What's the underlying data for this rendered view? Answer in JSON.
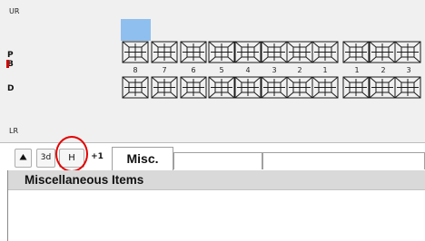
{
  "chart": {
    "label_upper_right": "UR",
    "label_lower_right": "LR",
    "side_letters": [
      "P",
      "B",
      "D"
    ],
    "upper_numbers_right": [
      "8",
      "7",
      "6",
      "5",
      "4",
      "3",
      "2",
      "1"
    ],
    "upper_numbers_left": [
      "1",
      "2",
      "3"
    ],
    "accent_color": "#8fbfef",
    "mark_color": "#d40000"
  },
  "toolbar": {
    "up_icon": "up-arrow-icon",
    "btn_3d": "3d",
    "btn_h": "H",
    "btn_plus1": "+1",
    "tab_misc": "Misc."
  },
  "panel": {
    "title": "Miscellaneous Items"
  },
  "annotation": {
    "circle_color": "#e40000"
  }
}
